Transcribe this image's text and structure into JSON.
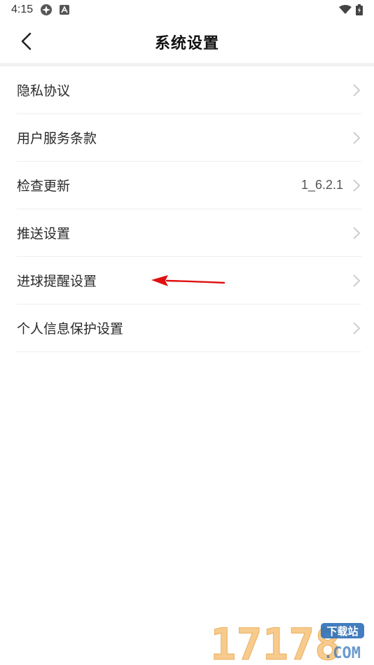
{
  "status_bar": {
    "time": "4:15"
  },
  "header": {
    "title": "系统设置"
  },
  "settings": [
    {
      "label": "隐私协议",
      "value": ""
    },
    {
      "label": "用户服务条款",
      "value": ""
    },
    {
      "label": "检查更新",
      "value": "1_6.2.1"
    },
    {
      "label": "推送设置",
      "value": ""
    },
    {
      "label": "进球提醒设置",
      "value": ""
    },
    {
      "label": "个人信息保护设置",
      "value": ""
    }
  ],
  "watermark": {
    "number": "17178",
    "badge": "下载站",
    "domain": ".COM"
  },
  "colors": {
    "annotation_arrow": "#e01010",
    "watermark_orange": "#f0a030",
    "watermark_blue": "#2e6fb8"
  }
}
